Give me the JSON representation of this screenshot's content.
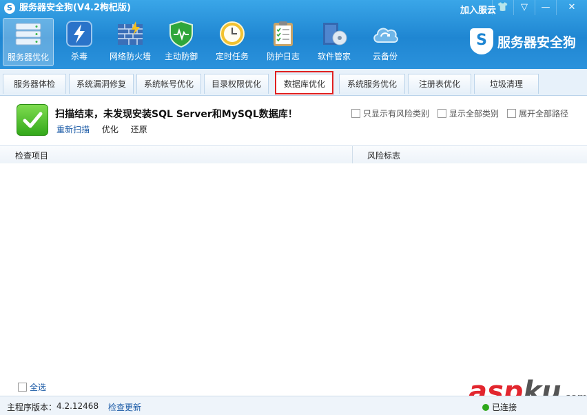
{
  "window": {
    "title": "服务器安全狗(V4.2枸杞版)",
    "join_cloud": "加入服云",
    "controls": [
      "👕",
      "▽",
      "—",
      "✕"
    ]
  },
  "toolbar": {
    "items": [
      {
        "label": "服务器优化",
        "icon": "server-icon",
        "color": "#cfe2f3"
      },
      {
        "label": "杀毒",
        "icon": "lightning-icon",
        "color": "#2a73c9"
      },
      {
        "label": "网络防火墙",
        "icon": "firewall-icon",
        "color": "#3b6fb8"
      },
      {
        "label": "主动防御",
        "icon": "shield-icon",
        "color": "#2fa63a"
      },
      {
        "label": "定时任务",
        "icon": "clock-icon",
        "color": "#f2c230"
      },
      {
        "label": "防护日志",
        "icon": "clipboard-icon",
        "color": "#c9a468"
      },
      {
        "label": "软件管家",
        "icon": "software-box-icon",
        "color": "#3468b0"
      },
      {
        "label": "云备份",
        "icon": "cloud-icon",
        "color": "#6fb6e8"
      }
    ]
  },
  "brand": {
    "text": "服务器安全狗",
    "logo": "S"
  },
  "tabs": [
    {
      "label": "服务器体检"
    },
    {
      "label": "系统漏洞修复"
    },
    {
      "label": "系统帐号优化"
    },
    {
      "label": "目录权限优化"
    },
    {
      "label": "数据库优化"
    },
    {
      "label": "系统服务优化"
    },
    {
      "label": "注册表优化"
    },
    {
      "label": "垃圾清理"
    }
  ],
  "result": {
    "message": "扫描结束，未发现安装SQL Server和MySQL数据库！",
    "actions": [
      "重新扫描",
      "优化",
      "还原"
    ],
    "options": [
      "只显示有风险类别",
      "显示全部类别",
      "展开全部路径"
    ]
  },
  "table": {
    "columns": [
      "检查项目",
      "风险标志"
    ]
  },
  "footer": {
    "select_all": "全选",
    "version_label": "主程序版本：",
    "version": "4.2.12468",
    "update": "检查更新",
    "connection": "已连接",
    "watermark": {
      "asp": "asp",
      "ku": "ku",
      "com": ".com"
    }
  },
  "colors": {
    "accent": "#1f86d2",
    "highlight": "#e02020",
    "link": "#1a5aa6"
  }
}
